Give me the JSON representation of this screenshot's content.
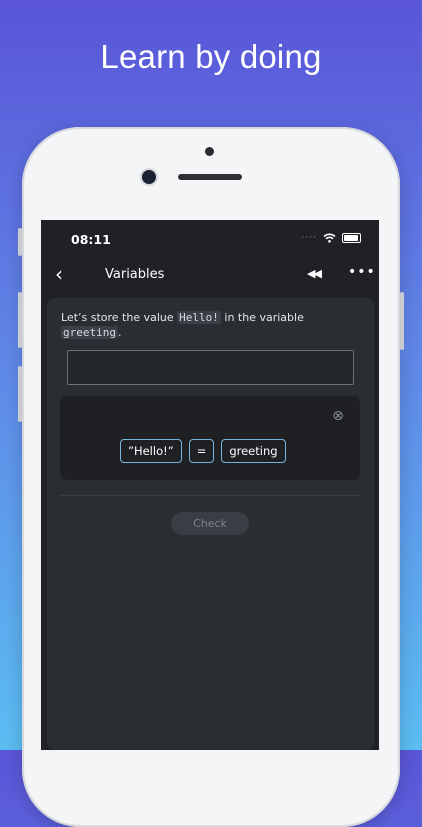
{
  "headline": "Learn by doing",
  "status_bar": {
    "time": "08:11"
  },
  "nav": {
    "back_icon": "chevron-left-icon",
    "title": "Variables",
    "rewind_icon": "rewind-icon",
    "more_icon": "more-icon"
  },
  "exercise": {
    "prompt_before": "Let’s store the value ",
    "prompt_value": "Hello!",
    "prompt_middle": " in the variable ",
    "prompt_variable": "greeting",
    "prompt_end": ".",
    "answer_value": "",
    "tokens": [
      "”Hello!”",
      "=",
      "greeting"
    ],
    "check_label": "Check"
  },
  "colors": {
    "accent": "#78b7dd",
    "screen_bg": "#1f2125",
    "card_bg": "#2a2d32"
  }
}
